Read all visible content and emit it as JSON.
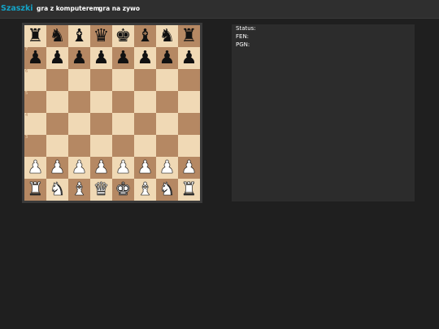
{
  "navbar": {
    "brand": "Szaszki",
    "links": [
      {
        "label": "gra z komputerem"
      },
      {
        "label": "gra na zywo"
      }
    ]
  },
  "board": {
    "light_color": "#f0d9b5",
    "dark_color": "#b58863",
    "rank_notes": [
      "7",
      "6",
      "5",
      "4",
      "3"
    ],
    "position": [
      [
        "bR",
        "bN",
        "bB",
        "bQ",
        "bK",
        "bB",
        "bN",
        "bR"
      ],
      [
        "bP",
        "bP",
        "bP",
        "bP",
        "bP",
        "bP",
        "bP",
        "bP"
      ],
      [
        "",
        "",
        "",
        "",
        "",
        "",
        "",
        ""
      ],
      [
        "",
        "",
        "",
        "",
        "",
        "",
        "",
        ""
      ],
      [
        "",
        "",
        "",
        "",
        "",
        "",
        "",
        ""
      ],
      [
        "",
        "",
        "",
        "",
        "",
        "",
        "",
        ""
      ],
      [
        "wP",
        "wP",
        "wP",
        "wP",
        "wP",
        "wP",
        "wP",
        "wP"
      ],
      [
        "wR",
        "wN",
        "wB",
        "wQ",
        "wK",
        "wB",
        "wN",
        "wR"
      ]
    ]
  },
  "info": {
    "status_label": "Status:",
    "fen_label": "FEN:",
    "pgn_label": "PGN:"
  }
}
